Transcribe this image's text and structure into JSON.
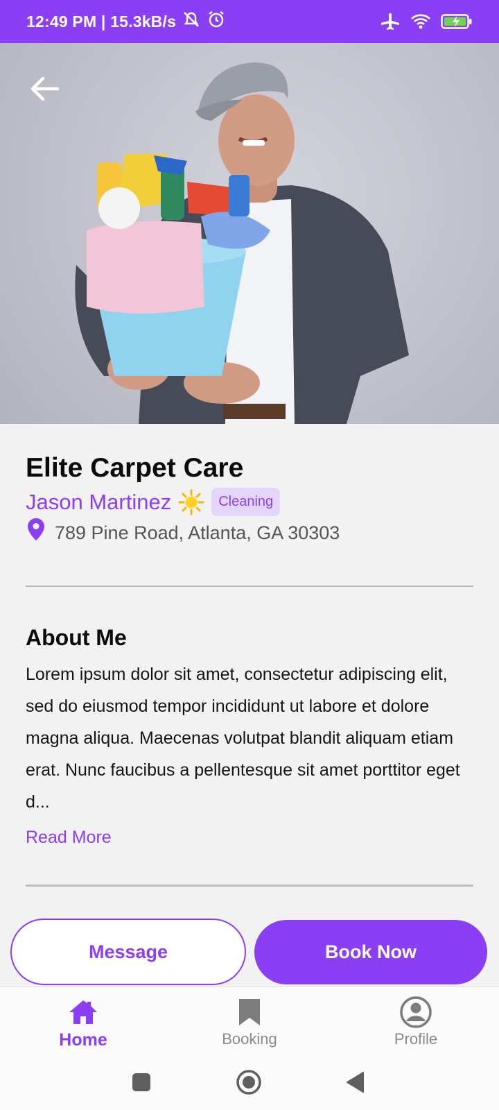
{
  "status_bar": {
    "time_and_speed": "12:49 PM | 15.3kB/s"
  },
  "business": {
    "title": "Elite Carpet Care",
    "provider_name": "Jason Martinez",
    "category": "Cleaning",
    "address": "789 Pine Road, Atlanta, GA 30303"
  },
  "about": {
    "heading": "About Me",
    "text": "Lorem ipsum dolor sit amet, consectetur adipiscing elit, sed do eiusmod tempor incididunt ut labore et dolore magna aliqua. Maecenas volutpat blandit aliquam etiam erat. Nunc faucibus a pellentesque sit amet porttitor eget d...",
    "read_more": "Read More"
  },
  "actions": {
    "message": "Message",
    "book_now": "Book Now"
  },
  "bottom_nav": [
    {
      "label": "Home",
      "icon": "home-icon",
      "active": true
    },
    {
      "label": "Booking",
      "icon": "bookmark-icon",
      "active": false
    },
    {
      "label": "Profile",
      "icon": "profile-icon",
      "active": false
    }
  ],
  "colors": {
    "accent": "#8b3ff5",
    "badge_bg": "#e4d6fb",
    "background": "#f2f2f2"
  }
}
